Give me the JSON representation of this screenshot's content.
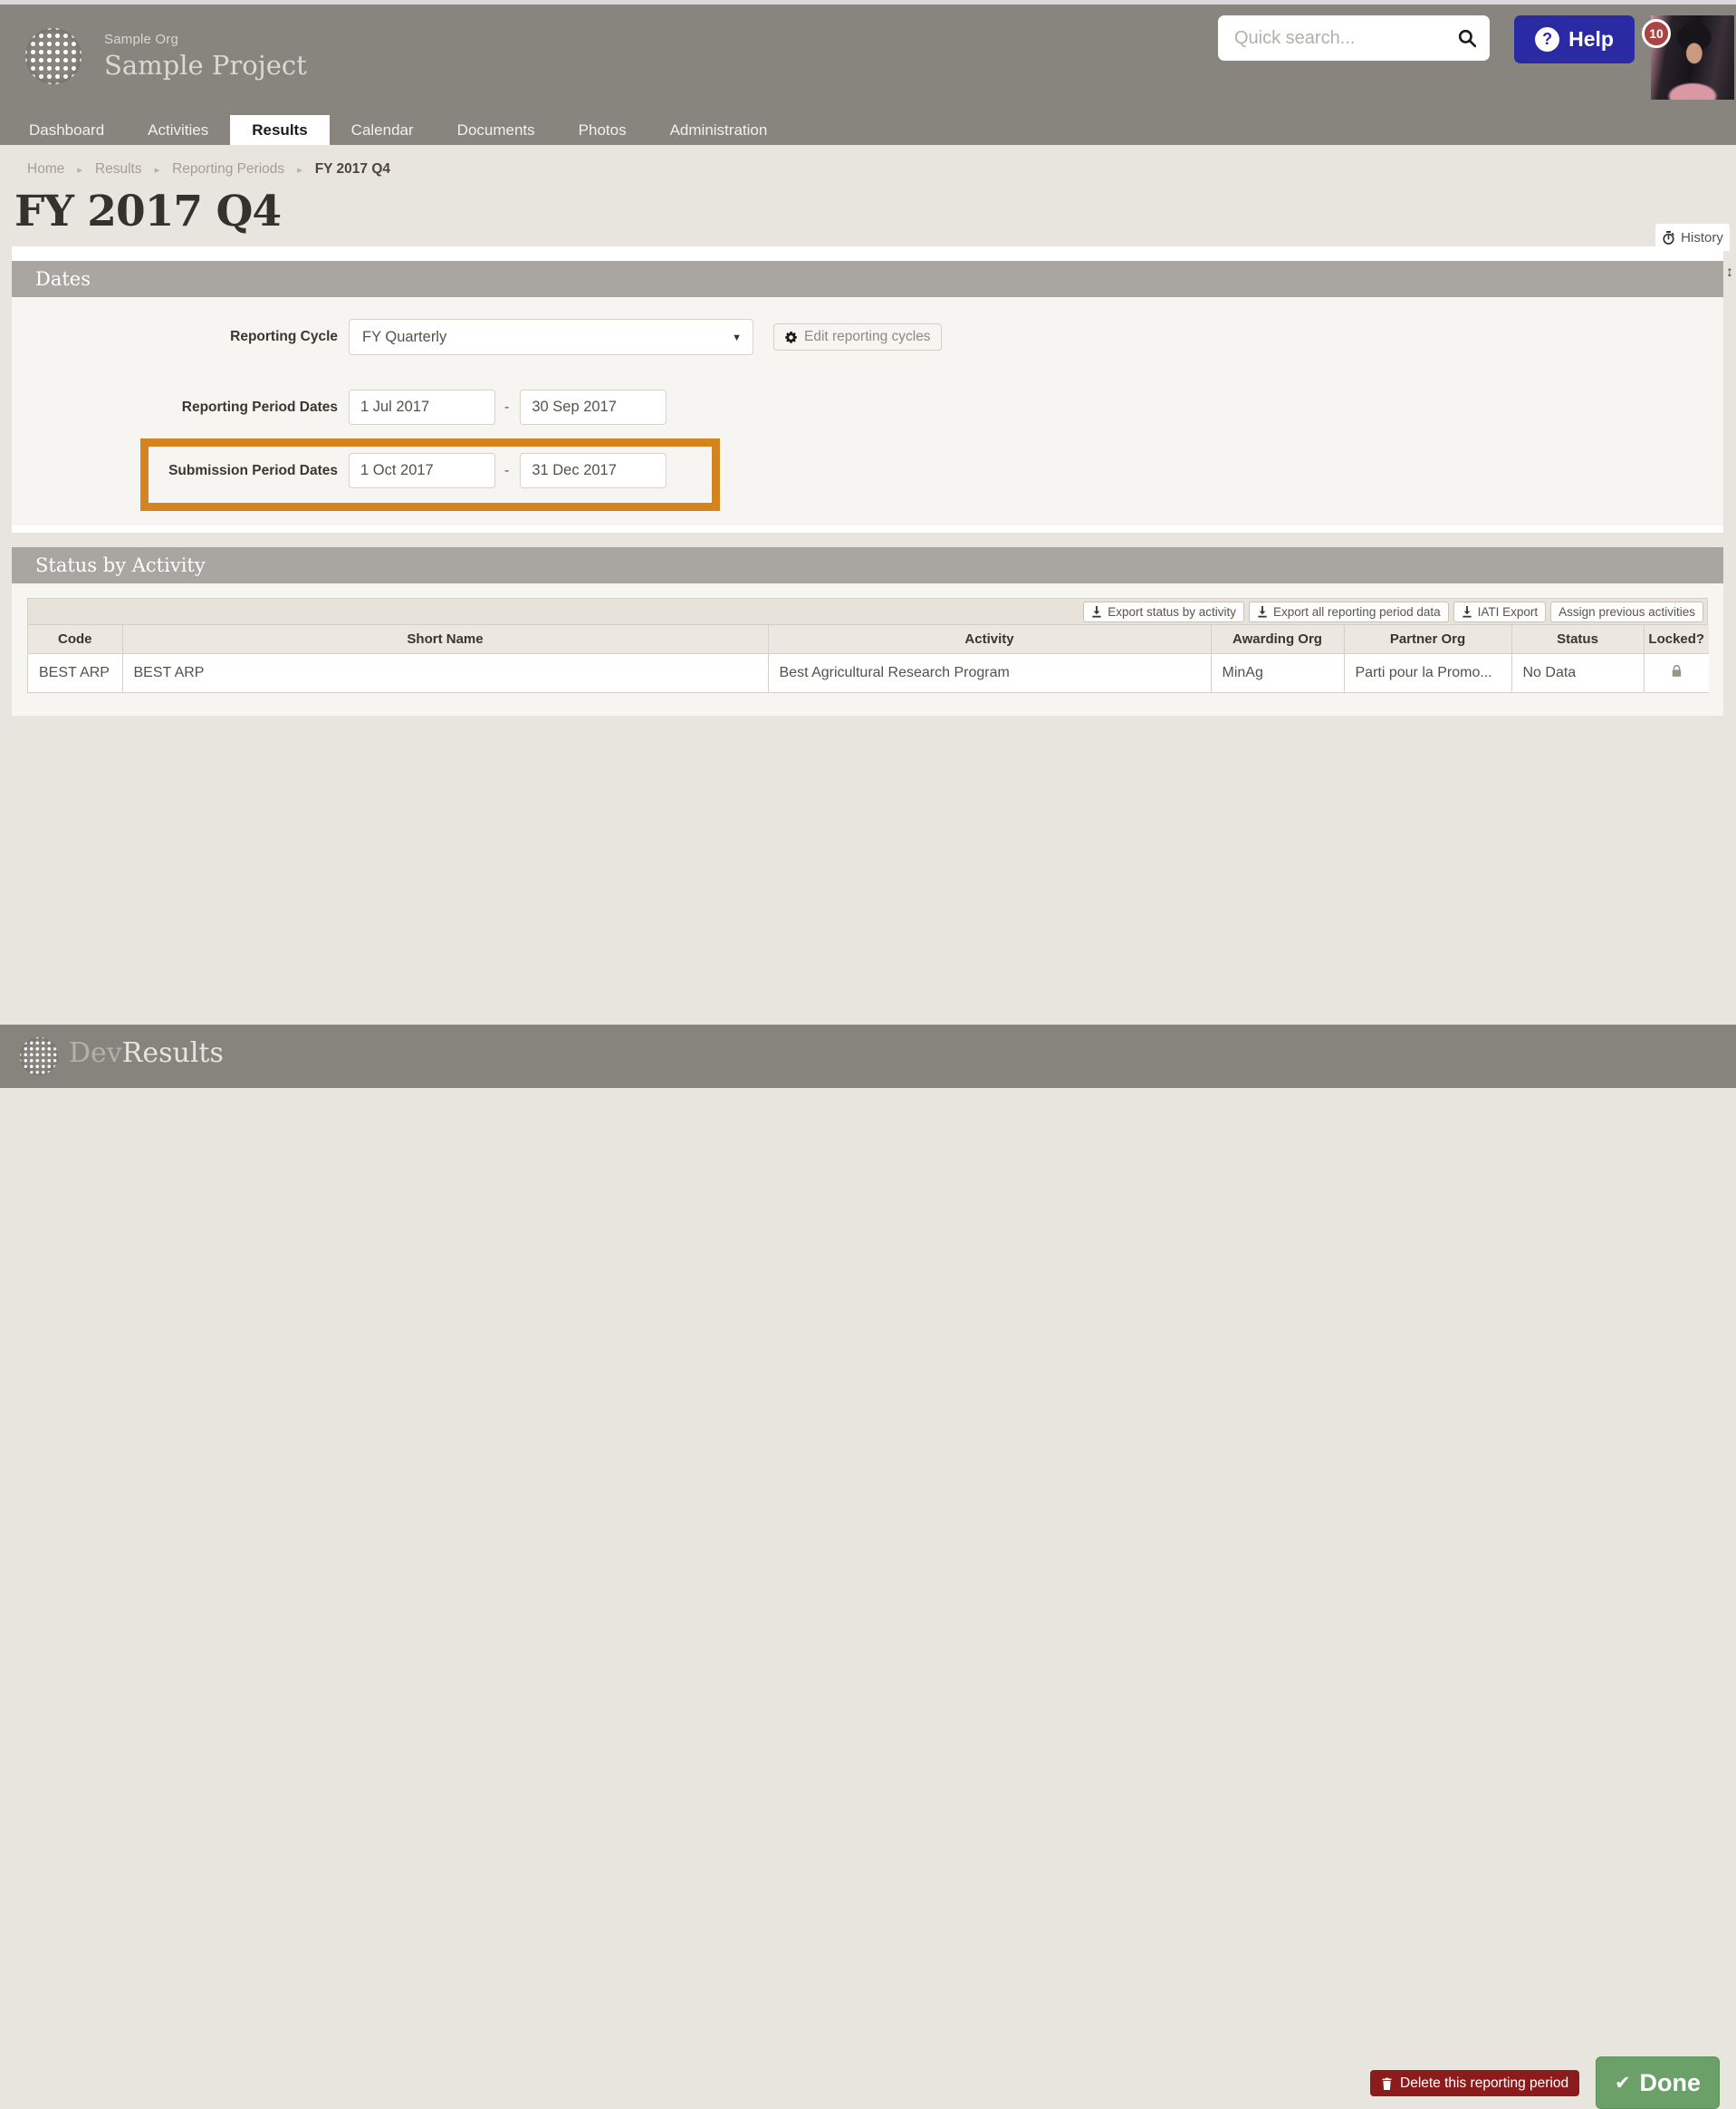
{
  "colors": {
    "header_gray": "#88857f",
    "section_bar_gray": "#a9a6a2",
    "page_bg": "#e8e4de",
    "panel_bg": "#f7f5f1",
    "highlight_orange": "#d5831e",
    "help_blue": "#2b2aa5",
    "badge_red": "#a94442",
    "delete_red": "#8c1c1c",
    "done_green": "#6ba169"
  },
  "header": {
    "org_name": "Sample Org",
    "project_name": "Sample Project",
    "search_placeholder": "Quick search...",
    "help_icon": "?",
    "help_label": "Help",
    "notification_count": "10"
  },
  "nav": {
    "tabs": [
      {
        "label": "Dashboard",
        "active": false
      },
      {
        "label": "Activities",
        "active": false
      },
      {
        "label": "Results",
        "active": true
      },
      {
        "label": "Calendar",
        "active": false
      },
      {
        "label": "Documents",
        "active": false
      },
      {
        "label": "Photos",
        "active": false
      },
      {
        "label": "Administration",
        "active": false
      }
    ]
  },
  "breadcrumb": {
    "separator": "▸",
    "items": [
      "Home",
      "Results",
      "Reporting Periods",
      "FY 2017 Q4"
    ]
  },
  "page": {
    "title": "FY 2017 Q4",
    "history_label": "History",
    "scroll_hint": "↕"
  },
  "dates": {
    "section_title": "Dates",
    "reporting_cycle": {
      "label": "Reporting Cycle",
      "value": "FY Quarterly",
      "dropdown_arrow": "▼"
    },
    "edit_cycles_label": "Edit reporting cycles",
    "range_separator": "-",
    "reporting_period": {
      "label": "Reporting Period Dates",
      "start": "1 Jul 2017",
      "end": "30 Sep 2017"
    },
    "submission_period": {
      "label": "Submission Period Dates",
      "start": "1 Oct 2017",
      "end": "31 Dec 2017"
    }
  },
  "status": {
    "section_title": "Status by Activity",
    "toolbar": {
      "export_status_label": "Export status by activity",
      "export_all_label": "Export all reporting period data",
      "iati_export_label": "IATI Export",
      "assign_previous_label": "Assign previous activities"
    },
    "table": {
      "columns": [
        "Code",
        "Short Name",
        "Activity",
        "Awarding Org",
        "Partner Org",
        "Status",
        "Locked?"
      ],
      "rows": [
        {
          "code": "BEST ARP",
          "short_name": "BEST ARP",
          "activity": "Best Agricultural Research Program",
          "awarding_org": "MinAg",
          "partner_org": "Parti pour la Promo...",
          "status": "No Data"
        }
      ]
    }
  },
  "footer": {
    "brand_prefix": "Dev",
    "brand_suffix": "Results",
    "delete_label": "Delete this reporting period",
    "done_check": "✔",
    "done_label": "Done"
  }
}
